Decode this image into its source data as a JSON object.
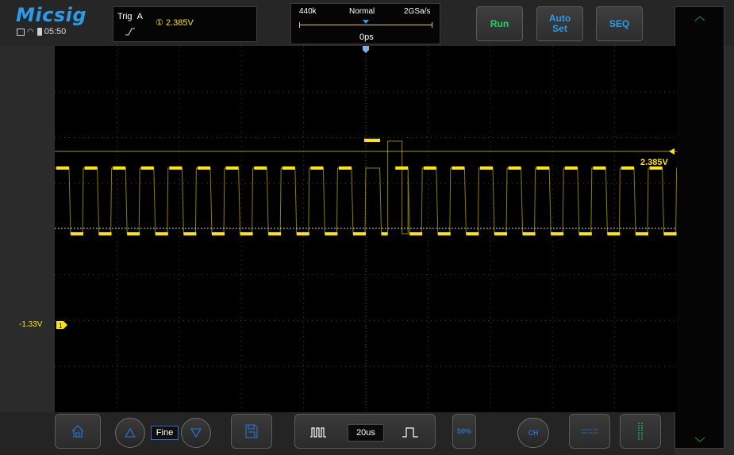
{
  "brand": "Micsig",
  "status": {
    "time": "05:50"
  },
  "trigger": {
    "label": "Trig",
    "source": "A",
    "channel_marker": "①",
    "level": "2.385V"
  },
  "timebase_panel": {
    "memory_depth": "440k",
    "mode": "Normal",
    "sample_rate": "2GSa/s",
    "delay": "0ps"
  },
  "buttons": {
    "run": "Run",
    "auto_line1": "Auto",
    "auto_line2": "Set",
    "seq": "SEQ"
  },
  "screen": {
    "trigger_level_label": "2.385V",
    "channel_offset_label": "-1.33V",
    "channel_number": "1"
  },
  "bottom": {
    "fine_label": "Fine",
    "timebase_value": "20us",
    "fifty_percent": "50%",
    "channel_button": "CH"
  },
  "colors": {
    "trace": "#ffe600",
    "accent": "#2b9bea",
    "run": "#21d65a"
  }
}
